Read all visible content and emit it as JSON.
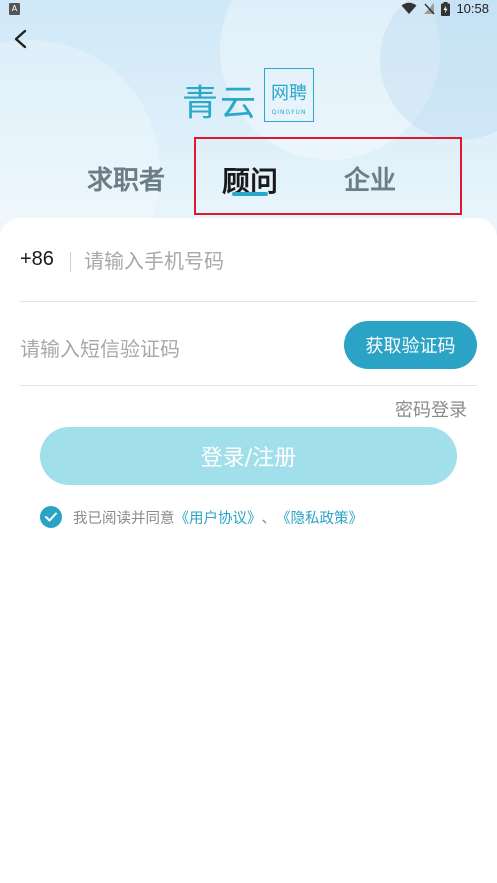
{
  "status_bar": {
    "time": "10:58",
    "left_icon_letter": "A"
  },
  "logo": {
    "main": "青云",
    "box_text": "网聘",
    "box_sub": "QINGYUN"
  },
  "tabs": [
    {
      "label": "求职者",
      "active": false
    },
    {
      "label": "顾问",
      "active": true
    },
    {
      "label": "企业",
      "active": false
    }
  ],
  "form": {
    "country_code": "+86",
    "phone_placeholder": "请输入手机号码",
    "code_placeholder": "请输入短信验证码",
    "get_code_label": "获取验证码",
    "password_login_label": "密码登录",
    "submit_label": "登录/注册"
  },
  "agreement": {
    "prefix": "我已阅读并同意",
    "user_agreement": "《用户协议》",
    "separator": "、",
    "privacy_policy": "《隐私政策》",
    "checked": true
  },
  "colors": {
    "accent": "#2aa3c4",
    "button_disabled": "#a1dfeb",
    "highlight": "#e0182c"
  }
}
